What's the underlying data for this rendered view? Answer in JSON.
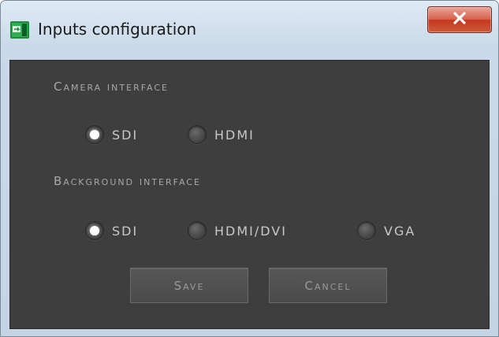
{
  "window": {
    "title": "Inputs configuration",
    "close_label": "X"
  },
  "camera": {
    "label": "Camera interface",
    "options": [
      {
        "label": "SDI",
        "selected": true
      },
      {
        "label": "HDMI",
        "selected": false
      }
    ]
  },
  "background": {
    "label": "Background interface",
    "options": [
      {
        "label": "SDI",
        "selected": true
      },
      {
        "label": "HDMI/DVI",
        "selected": false
      },
      {
        "label": "VGA",
        "selected": false
      }
    ]
  },
  "buttons": {
    "save": "Save",
    "cancel": "Cancel"
  },
  "colors": {
    "panel": "#3e3e3e",
    "text": "#c8c8c8",
    "close_red": "#c4391f"
  }
}
